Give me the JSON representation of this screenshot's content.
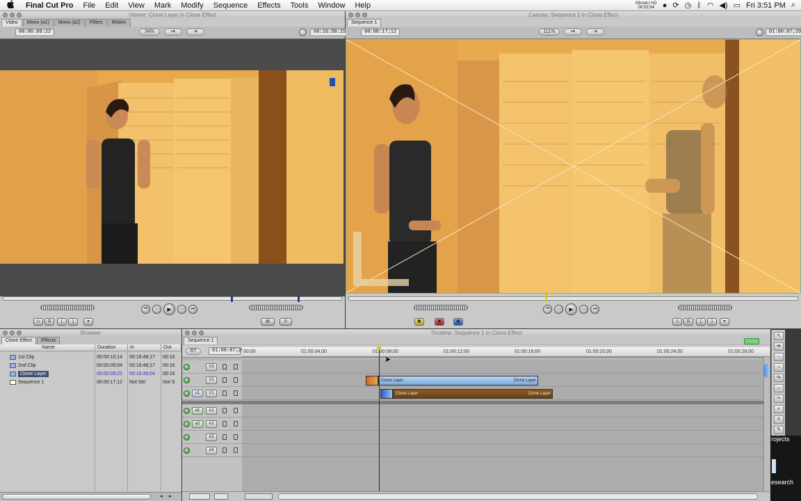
{
  "menubar": {
    "apple": "",
    "items": [
      "Final Cut Pro",
      "File",
      "Edit",
      "View",
      "Mark",
      "Modify",
      "Sequence",
      "Effects",
      "Tools",
      "Window",
      "Help"
    ],
    "status_top": "iShowU HD",
    "status_bottom": "00:02:54",
    "clock": "Fri 3:51 PM"
  },
  "viewer": {
    "title": "Viewer: Clone Layer in Clone Effect",
    "tabs": [
      "Video",
      "Mono (a1)",
      "Mono (a2)",
      "Filters",
      "Motion"
    ],
    "duration": "00:00:09:22",
    "zoom": "34%",
    "timecode": "00:16:58:25"
  },
  "canvas": {
    "title": "Canvas: Sequence 1 in Clone Effect",
    "tab": "Sequence 1",
    "duration": "00:00:17;12",
    "zoom": "111%",
    "timecode": "01:00:07;20"
  },
  "browser": {
    "title": "Browser",
    "tabs": [
      "Clone Effect",
      "Effects"
    ],
    "columns": [
      "Name",
      "Duration",
      "In",
      "Out"
    ],
    "rows": [
      {
        "name": "1st Clip",
        "duration": "00:00:10;14",
        "in": "00:16:48;17",
        "out": "00:16"
      },
      {
        "name": "2nd Clip",
        "duration": "00:00:09;04",
        "in": "00:16:48;17",
        "out": "00:16"
      },
      {
        "name": "Clone Layer",
        "duration": "00:00:09;22",
        "in": "00:16:49;04",
        "out": "00:16"
      },
      {
        "name": "Sequence 1",
        "duration": "00:00:17;12",
        "in": "Not Set",
        "out": "Not S"
      }
    ]
  },
  "timeline": {
    "title": "Timeline: Sequence 1 in Clone Effect",
    "tab": "Sequence 1",
    "rt": "RT",
    "timecode": "01:00:07;20",
    "ruler": [
      "00:00",
      "01:00:04;00",
      "01:00:08;00",
      "01:00:12;00",
      "01:00:16;00",
      "01:00:20;00",
      "01:00:24;00",
      "01:00:28;00"
    ],
    "video_tracks": [
      {
        "src": "",
        "dest": "V3",
        "clips": []
      },
      {
        "src": "",
        "dest": "V2",
        "clips": [
          {
            "label": "Clone Layer",
            "end_label": "Clone Layer"
          }
        ]
      },
      {
        "src": "v1",
        "dest": "V1",
        "clips": [
          {
            "label": "Clone Layer",
            "end_label": "Clone Layer"
          }
        ]
      }
    ],
    "audio_tracks": [
      {
        "src": "a1",
        "dest": "A1"
      },
      {
        "src": "a2",
        "dest": "A2"
      },
      {
        "src": "",
        "dest": "A3"
      },
      {
        "src": "",
        "dest": "A4"
      }
    ]
  },
  "desktop_peek": {
    "text1": "rojects",
    "text2": "esearch"
  },
  "colors": {
    "accent_green": "#2e8a33",
    "clip_blue": "#8fb6e0",
    "clip_brown": "#7a4a14",
    "video_warm": "#e9b25a"
  }
}
